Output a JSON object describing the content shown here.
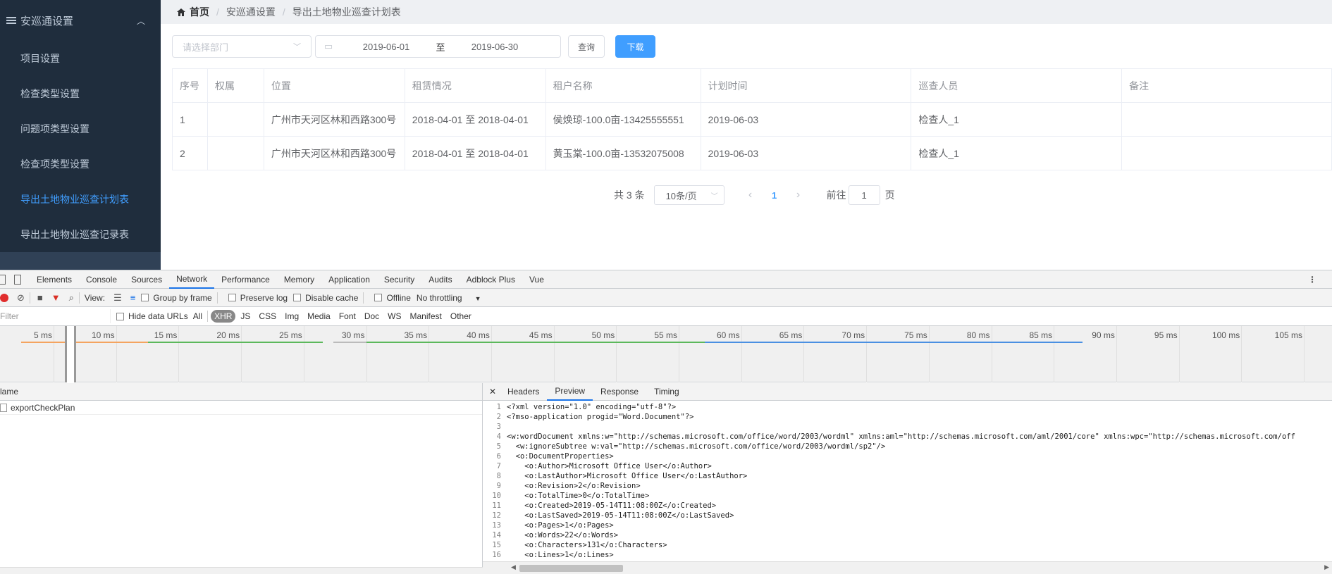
{
  "sidebar": {
    "group_label": "安巡通设置",
    "items": [
      {
        "label": "项目设置"
      },
      {
        "label": "检查类型设置"
      },
      {
        "label": "问题项类型设置"
      },
      {
        "label": "检查项类型设置"
      },
      {
        "label": "导出土地物业巡查计划表",
        "active": true
      },
      {
        "label": "导出土地物业巡查记录表"
      }
    ]
  },
  "breadcrumb": {
    "home": "首页",
    "items": [
      "安巡通设置",
      "导出土地物业巡查计划表"
    ]
  },
  "filters": {
    "department_placeholder": "请选择部门",
    "start_date": "2019-06-01",
    "range_separator": "至",
    "end_date": "2019-06-30",
    "query_label": "查询",
    "download_label": "下载"
  },
  "table": {
    "headers": [
      "序号",
      "权属",
      "位置",
      "租赁情况",
      "租户名称",
      "计划时间",
      "巡查人员",
      "备注"
    ],
    "rows": [
      [
        "1",
        "",
        "广州市天河区林和西路300号",
        "2018-04-01 至 2018-04-01",
        "侯焕琼-100.0亩-13425555551",
        "2019-06-03",
        "检查人_1",
        ""
      ],
      [
        "2",
        "",
        "广州市天河区林和西路300号",
        "2018-04-01 至 2018-04-01",
        "黄玉棠-100.0亩-13532075008",
        "2019-06-03",
        "检查人_1",
        ""
      ]
    ]
  },
  "pagination": {
    "total": "共 3 条",
    "page_size": "10条/页",
    "current_page": "1",
    "goto_label": "前往",
    "goto_value": "1",
    "page_unit": "页"
  },
  "devtools": {
    "tabs": [
      "Elements",
      "Console",
      "Sources",
      "Network",
      "Performance",
      "Memory",
      "Application",
      "Security",
      "Audits",
      "Adblock Plus",
      "Vue"
    ],
    "active_tab": "Network",
    "toolbar": {
      "view_label": "View:",
      "group_by_frame": "Group by frame",
      "preserve_log": "Preserve log",
      "disable_cache": "Disable cache",
      "offline": "Offline",
      "throttling": "No throttling"
    },
    "filter_placeholder": "Filter",
    "hide_data_urls": "Hide data URLs",
    "types": [
      "All",
      "XHR",
      "JS",
      "CSS",
      "Img",
      "Media",
      "Font",
      "Doc",
      "WS",
      "Manifest",
      "Other"
    ],
    "active_type": "XHR",
    "timeline_ticks": [
      "5 ms",
      "10 ms",
      "15 ms",
      "20 ms",
      "25 ms",
      "30 ms",
      "35 ms",
      "40 ms",
      "45 ms",
      "50 ms",
      "55 ms",
      "60 ms",
      "65 ms",
      "70 ms",
      "75 ms",
      "80 ms",
      "85 ms",
      "90 ms",
      "95 ms",
      "100 ms",
      "105 ms"
    ],
    "name_header": "lame",
    "request_name": "exportCheckPlan",
    "detail_tabs": [
      "Headers",
      "Preview",
      "Response",
      "Timing"
    ],
    "active_detail_tab": "Preview",
    "code_lines": [
      "<?xml version=\"1.0\" encoding=\"utf-8\"?>",
      "<?mso-application progid=\"Word.Document\"?>",
      "",
      "<w:wordDocument xmlns:w=\"http://schemas.microsoft.com/office/word/2003/wordml\" xmlns:aml=\"http://schemas.microsoft.com/aml/2001/core\" xmlns:wpc=\"http://schemas.microsoft.com/off",
      "  <w:ignoreSubtree w:val=\"http://schemas.microsoft.com/office/word/2003/wordml/sp2\"/>",
      "  <o:DocumentProperties>",
      "    <o:Author>Microsoft Office User</o:Author>",
      "    <o:LastAuthor>Microsoft Office User</o:LastAuthor>",
      "    <o:Revision>2</o:Revision>",
      "    <o:TotalTime>0</o:TotalTime>",
      "    <o:Created>2019-05-14T11:08:00Z</o:Created>",
      "    <o:LastSaved>2019-05-14T11:08:00Z</o:LastSaved>",
      "    <o:Pages>1</o:Pages>",
      "    <o:Words>22</o:Words>",
      "    <o:Characters>131</o:Characters>",
      "    <o:Lines>1</o:Lines>",
      ""
    ]
  }
}
